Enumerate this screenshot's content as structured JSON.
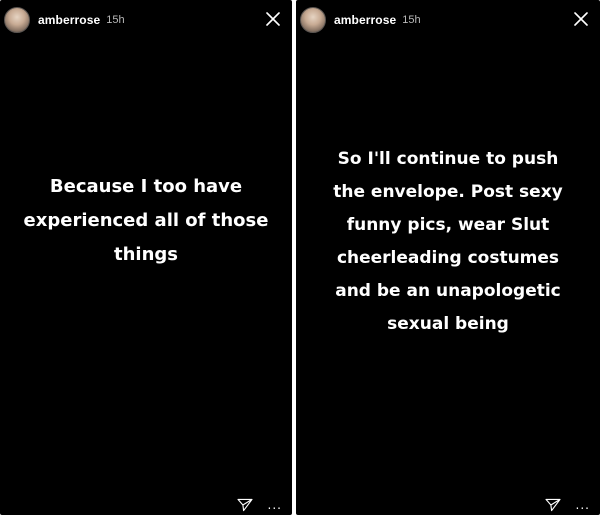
{
  "stories": [
    {
      "username": "amberrose",
      "time": "15h",
      "text": "Because I too have experienced all of those things",
      "footer_more": "..."
    },
    {
      "username": "amberrose",
      "time": "15h",
      "text": "So I'll continue to push the envelope. Post sexy funny pics, wear Slut cheerleading costumes and be an unapologetic sexual being",
      "footer_more": "..."
    }
  ],
  "icons": {
    "close": "close-icon",
    "send": "send-icon",
    "more": "more-options-icon"
  },
  "colors": {
    "background": "#000000",
    "text": "#ffffff",
    "timestamp": "#b9b9b9"
  }
}
